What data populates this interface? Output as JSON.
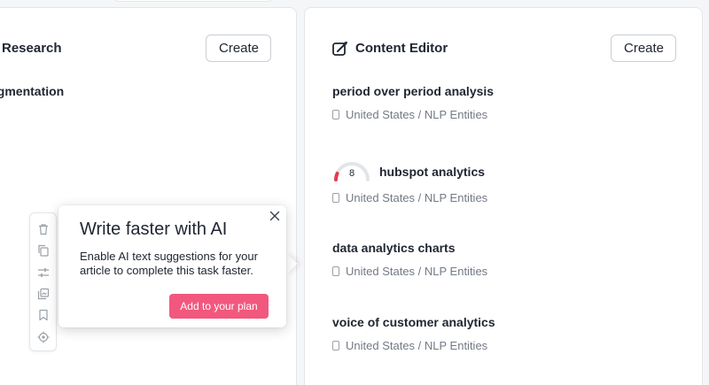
{
  "left_card": {
    "title": "Research",
    "create_label": "Create",
    "row_title": "egmentation"
  },
  "right_card": {
    "title": "Content Editor",
    "create_label": "Create",
    "items": [
      {
        "title": "period over period analysis",
        "subtitle": "United States / NLP Entities"
      },
      {
        "title": "hubspot analytics",
        "subtitle": "United States / NLP Entities",
        "score": "8"
      },
      {
        "title": "data analytics charts",
        "subtitle": "United States / NLP Entities"
      },
      {
        "title": "voice of customer analytics",
        "subtitle": "United States / NLP Entities"
      }
    ]
  },
  "toolbar": {
    "icons": [
      "trash-icon",
      "copy-icon",
      "sliders-icon",
      "gallery-icon",
      "bookmark-icon",
      "target-icon"
    ]
  },
  "popup": {
    "title": "Write faster with AI",
    "body": "Enable AI text suggestions for your article to complete this task faster.",
    "cta_label": "Add to your plan"
  },
  "colors": {
    "accent": "#f2587d",
    "gauge_red": "#e8384f",
    "gauge_track": "#e3e5e9"
  }
}
